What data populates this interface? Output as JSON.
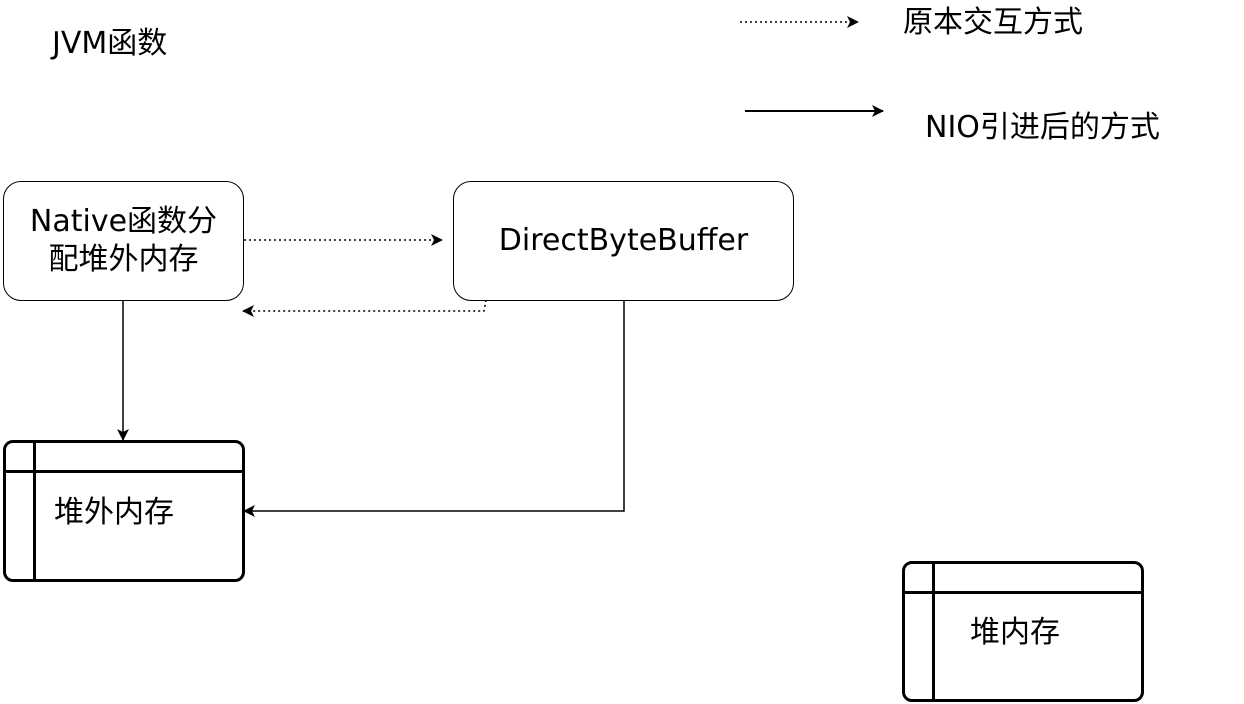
{
  "title": "JVM函数",
  "legend": {
    "original": {
      "label": "原本交互方式",
      "line_style": "dotted"
    },
    "nio": {
      "label": "NIO引进后的方式",
      "line_style": "solid"
    }
  },
  "nodes": {
    "native": {
      "line1": "Native函数分",
      "line2": "配堆外内存"
    },
    "direct_buffer": {
      "label": "DirectByteBuffer"
    },
    "off_heap": {
      "label": "堆外内存"
    },
    "heap": {
      "label": "堆内存"
    }
  },
  "colors": {
    "stroke": "#000000",
    "background": "#ffffff"
  }
}
